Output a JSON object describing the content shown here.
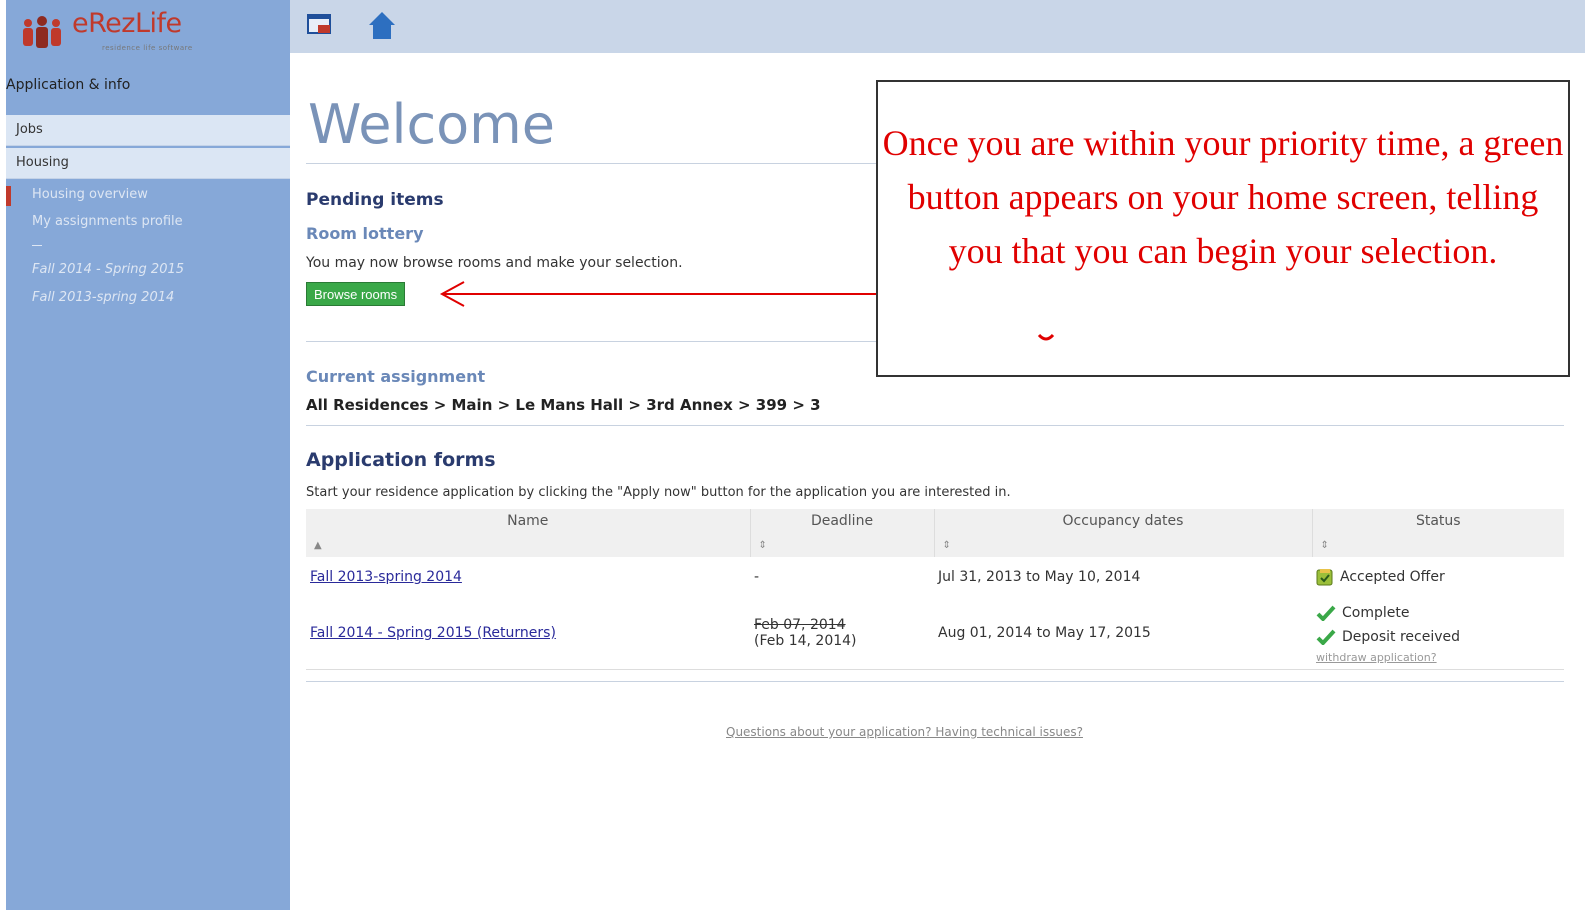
{
  "brand": {
    "name": "eRezLife",
    "tagline": "residence life software"
  },
  "sidebar": {
    "section_title": "Application & info",
    "rows": [
      "Jobs",
      "Housing"
    ],
    "items": [
      "Housing overview",
      "My assignments profile"
    ],
    "applications": [
      "Fall 2014 - Spring 2015",
      "Fall 2013-spring 2014"
    ]
  },
  "main": {
    "welcome": "Welcome",
    "pending_title": "Pending items",
    "lottery_title": "Room lottery",
    "lottery_text": "You may now browse rooms and make your selection.",
    "browse_button": "Browse rooms",
    "current_assignment_title": "Current assignment",
    "breadcrumb": "All Residences > Main > Le Mans Hall > 3rd Annex > 399 > 3",
    "forms_title": "Application forms",
    "forms_text": "Start your residence application by clicking the \"Apply now\" button for the application you are interested in.",
    "table": {
      "headers": [
        "Name",
        "Deadline",
        "Occupancy dates",
        "Status"
      ],
      "rows": [
        {
          "name": "Fall 2013-spring 2014",
          "deadline": "-",
          "deadline_extended": "",
          "occupancy": "Jul 31, 2013 to May 10, 2014",
          "statuses": [
            "Accepted Offer"
          ]
        },
        {
          "name": "Fall 2014 - Spring 2015 (Returners)",
          "deadline": "Feb 07, 2014",
          "deadline_extended": "(Feb 14, 2014)",
          "occupancy": "Aug 01, 2014 to May 17, 2015",
          "statuses": [
            "Complete",
            "Deposit received"
          ],
          "withdraw": "withdraw application?"
        }
      ]
    },
    "footer_link": "Questions about your application? Having technical issues?"
  },
  "callout": {
    "text": "Once you are within your priority time, a green button appears on your home screen, telling you that you can begin your selection."
  },
  "colors": {
    "sidebar_bg": "#86a8d8",
    "topbar_bg": "#c9d6e8",
    "button_green": "#3aa848",
    "callout_red": "#e00000"
  }
}
